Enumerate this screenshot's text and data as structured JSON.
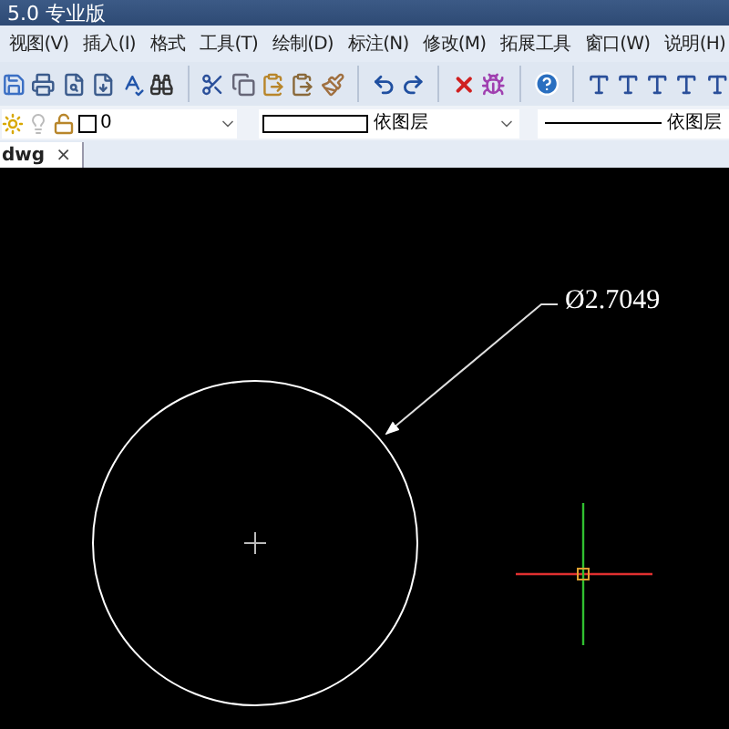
{
  "window": {
    "title": "5.0 专业版"
  },
  "menu": [
    "视图(V)",
    "插入(I)",
    "格式",
    "工具(T)",
    "绘制(D)",
    "标注(N)",
    "修改(M)",
    "拓展工具",
    "窗口(W)",
    "说明(H)"
  ],
  "properties": {
    "layer": "0",
    "color_setting": "依图层",
    "linetype": "依图层"
  },
  "tabs": [
    {
      "label": "dwg",
      "close": "×",
      "selected": true
    }
  ],
  "drawing": {
    "dimension_text": "Ø2.7049"
  }
}
